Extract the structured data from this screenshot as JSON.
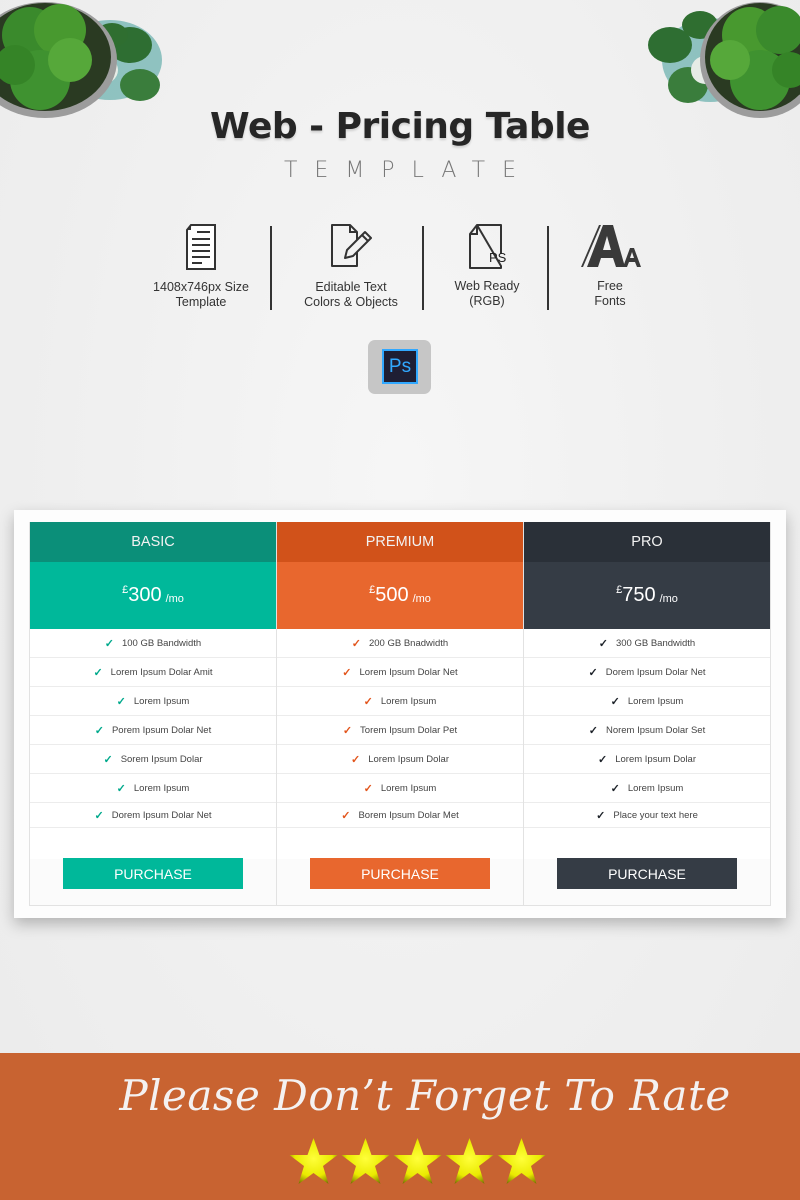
{
  "header": {
    "title": "Web - Pricing Table",
    "subtitle": "TEMPLATE"
  },
  "features": [
    {
      "icon": "document-icon",
      "label_line1": "1408x746px Size",
      "label_line2": "Template"
    },
    {
      "icon": "edit-file-icon",
      "label_line1": "Editable Text",
      "label_line2": "Colors & Objects"
    },
    {
      "icon": "psd-file-icon",
      "icon_text": "PSD",
      "label_line1": "Web Ready",
      "label_line2": "(RGB)"
    },
    {
      "icon": "fonts-icon",
      "label_line1": "Free",
      "label_line2": "Fonts"
    }
  ],
  "ps_badge": {
    "label": "Ps"
  },
  "pricing": {
    "plans": [
      {
        "name": "BASIC",
        "currency": "£",
        "amount": "300",
        "period": "/mo",
        "head_color": "#0b8f79",
        "price_color": "#00b89a",
        "check_color": "#00a98c",
        "features": [
          "100 GB Bandwidth",
          "Lorem Ipsum Dolar Amit",
          "Lorem Ipsum",
          "Porem Ipsum Dolar Net",
          "Sorem Ipsum Dolar",
          "Lorem Ipsum",
          "Dorem Ipsum Dolar Net"
        ],
        "button_label": "PURCHASE"
      },
      {
        "name": "PREMIUM",
        "currency": "£",
        "amount": "500",
        "period": "/mo",
        "head_color": "#d1521a",
        "price_color": "#e8672e",
        "check_color": "#e2551c",
        "features": [
          "200 GB Bnadwidth",
          "Lorem Ipsum Dolar Net",
          "Lorem Ipsum",
          "Torem Ipsum Dolar Pet",
          "Lorem Ipsum Dolar",
          "Lorem Ipsum",
          "Borem Ipsum Dolar Met"
        ],
        "button_label": "PURCHASE"
      },
      {
        "name": "PRO",
        "currency": "£",
        "amount": "750",
        "period": "/mo",
        "head_color": "#2a3038",
        "price_color": "#353c45",
        "check_color": "#1d2229",
        "features": [
          "300 GB Bandwidth",
          "Dorem Ipsum Dolar Net",
          "Lorem Ipsum",
          "Norem Ipsum Dolar Set",
          "Lorem Ipsum Dolar",
          "Lorem Ipsum",
          "Place your text here"
        ],
        "button_label": "PURCHASE"
      }
    ]
  },
  "banner": {
    "text": "Please Don’t Forget To Rate",
    "rating": 5,
    "max_rating": 5,
    "background": "#c86331"
  }
}
